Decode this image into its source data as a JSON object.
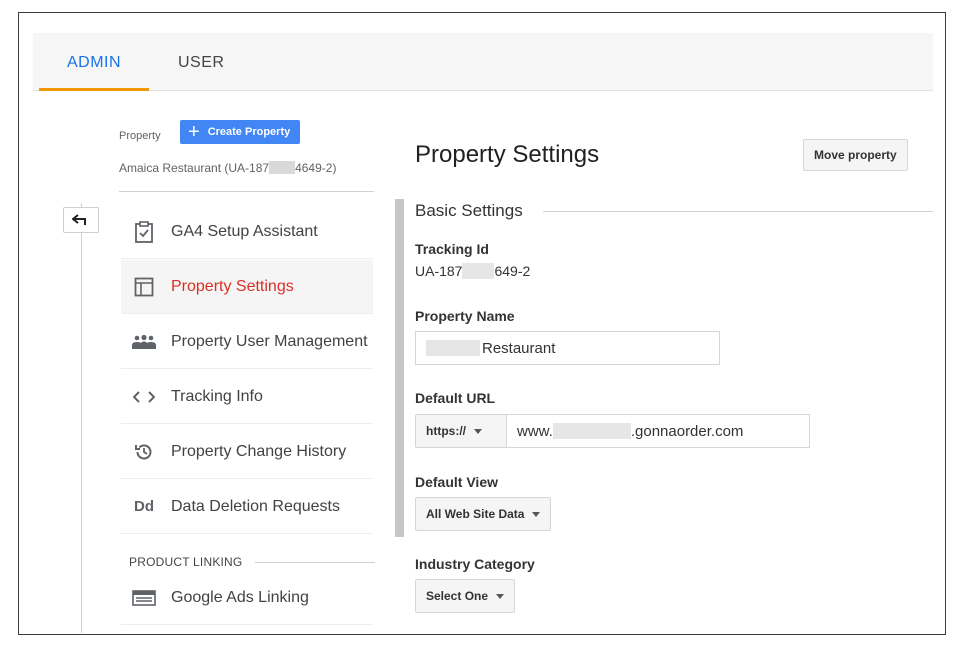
{
  "tabs": {
    "admin_label": "ADMIN",
    "user_label": "USER"
  },
  "property_header": {
    "label": "Property",
    "create_button_label": "Create Property",
    "name_prefix": "Amaica Restaurant (UA-187",
    "name_suffix": "4649-2)"
  },
  "nav": {
    "items": [
      {
        "label": "GA4 Setup Assistant",
        "icon": "checklist-icon"
      },
      {
        "label": "Property Settings",
        "icon": "window-icon",
        "active": true
      },
      {
        "label": "Property User Management",
        "icon": "people-icon"
      },
      {
        "label": "Tracking Info",
        "icon": "code-icon"
      },
      {
        "label": "Property Change History",
        "icon": "history-icon"
      },
      {
        "label": "Data Deletion Requests",
        "icon": "dd-icon"
      }
    ],
    "section_heading": "PRODUCT LINKING",
    "linking_items": [
      {
        "label": "Google Ads Linking",
        "icon": "ads-panel-icon"
      }
    ],
    "dd_glyph": "Dd"
  },
  "panel": {
    "title": "Property Settings",
    "move_button_label": "Move property",
    "basic_settings_title": "Basic Settings",
    "tracking_id_label": "Tracking Id",
    "tracking_id_prefix": "UA-187",
    "tracking_id_suffix": "649-2",
    "property_name_label": "Property Name",
    "property_name_value": "Restaurant",
    "default_url_label": "Default URL",
    "protocol_value": "https://",
    "url_prefix": "www.",
    "url_suffix": ".gonnaorder.com",
    "default_view_label": "Default View",
    "default_view_value": "All Web Site Data",
    "industry_label": "Industry Category",
    "industry_value": "Select One"
  },
  "colors": {
    "accent_blue": "#1a73e8",
    "tab_underline": "#f29900",
    "active_item": "#d93025",
    "create_button": "#4285f4"
  }
}
